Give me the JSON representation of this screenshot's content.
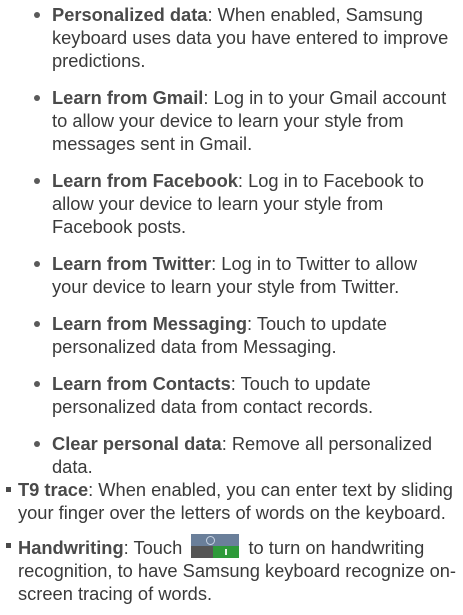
{
  "sub_items": [
    {
      "term": "Personalized data",
      "text": ": When enabled, Samsung keyboard uses data you have entered to improve predictions."
    },
    {
      "term": "Learn from Gmail",
      "text": ": Log in to your Gmail account to allow your device to learn your style from messages sent in Gmail."
    },
    {
      "term": "Learn from Facebook",
      "text": ": Log in to Facebook to allow your device to learn your style from Facebook posts."
    },
    {
      "term": "Learn from Twitter",
      "text": ": Log in to Twitter to allow your device to learn your style from Twitter."
    },
    {
      "term": "Learn from Messaging",
      "text": ": Touch to update personalized data from Messaging."
    },
    {
      "term": "Learn from Contacts",
      "text": ": Touch to update personalized data from contact records."
    },
    {
      "term": "Clear personal data",
      "text": ": Remove all personalized data."
    }
  ],
  "main_items": [
    {
      "term": "T9 trace",
      "text": ": When enabled, you can enter text by sliding your finger over the letters of words on the keyboard."
    },
    {
      "term": "Handwriting",
      "text_before": ": Touch",
      "icon": "on-off-toggle-icon",
      "text_after": "to turn on handwriting recognition, to have Samsung keyboard recognize on-screen tracing of words."
    }
  ]
}
